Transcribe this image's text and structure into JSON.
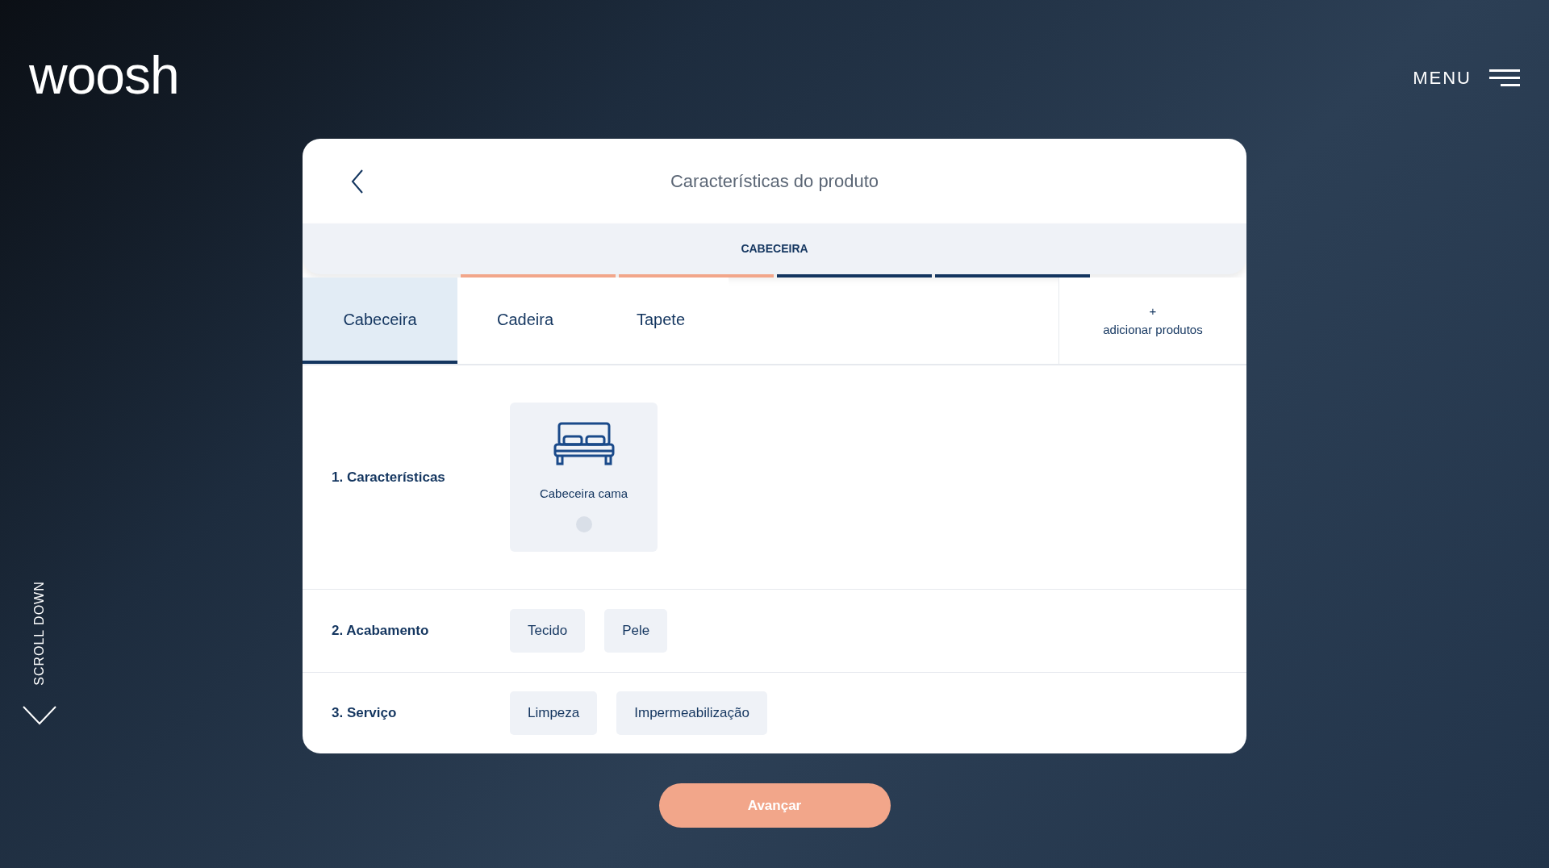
{
  "logo": "woosh",
  "menu": {
    "label": "MENU"
  },
  "scroll_hint": "SCROLL DOWN",
  "dialog": {
    "title": "Características do produto",
    "current_product": "CABECEIRA",
    "progress": [
      {
        "done": true
      },
      {
        "done": true
      },
      {
        "done": false
      },
      {
        "done": false
      }
    ],
    "tabs": [
      {
        "label": "Cabeceira",
        "selected": true
      },
      {
        "label": "Cadeira",
        "selected": false
      },
      {
        "label": "Tapete",
        "selected": false
      }
    ],
    "add_products": {
      "symbol": "+",
      "label": "adicionar produtos"
    },
    "sections": [
      {
        "kind": "cards",
        "label": "1. Características",
        "options": [
          {
            "label": "Cabeceira cama",
            "selected": false
          }
        ]
      },
      {
        "kind": "chips",
        "label": "2. Acabamento",
        "options": [
          {
            "label": "Tecido",
            "selected": false
          },
          {
            "label": "Pele",
            "selected": false
          }
        ]
      },
      {
        "kind": "chips",
        "label": "3. Serviço",
        "options": [
          {
            "label": "Limpeza",
            "selected": false
          },
          {
            "label": "Impermeabilização",
            "selected": false
          }
        ]
      }
    ]
  },
  "next_button": "Avançar"
}
